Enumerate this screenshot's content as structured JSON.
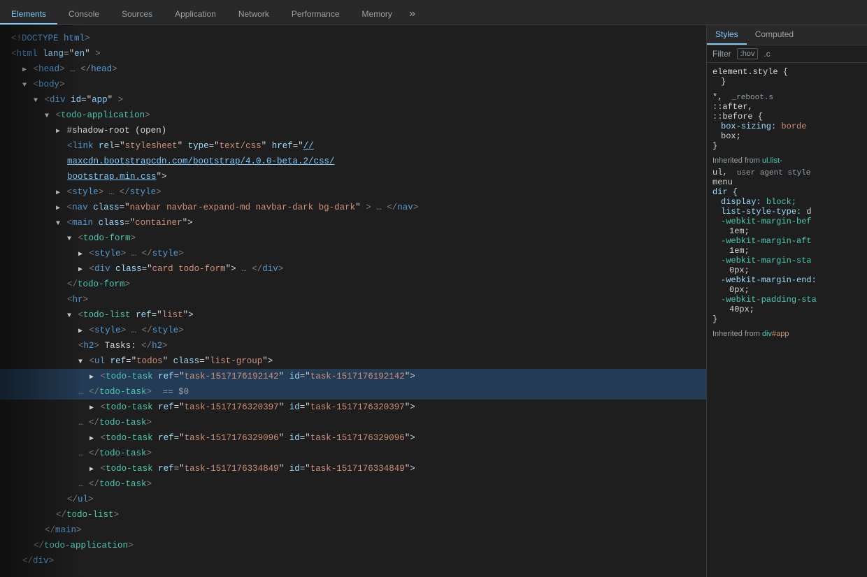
{
  "tabs": {
    "items": [
      {
        "label": "Elements",
        "active": false
      },
      {
        "label": "Console",
        "active": false
      },
      {
        "label": "Sources",
        "active": false
      },
      {
        "label": "Application",
        "active": false
      },
      {
        "label": "Network",
        "active": false
      },
      {
        "label": "Performance",
        "active": false
      },
      {
        "label": "Memory",
        "active": false
      },
      {
        "label": "»",
        "active": false
      }
    ]
  },
  "styles_tabs": {
    "items": [
      {
        "label": "Styles",
        "active": true
      },
      {
        "label": "Computed",
        "active": false
      }
    ]
  },
  "filter": {
    "label": "Filter",
    "hov": ":hov",
    "dot": ".c"
  },
  "dom": {
    "lines": [
      {
        "indent": 0,
        "text": "<!DOCTYPE html>"
      },
      {
        "indent": 0,
        "text": "<html lang=\"en\">"
      },
      {
        "indent": 1,
        "text": "▶ <head>…</head>"
      },
      {
        "indent": 1,
        "text": "▼ <body>"
      },
      {
        "indent": 2,
        "text": "▼ <div id=\"app\">"
      },
      {
        "indent": 3,
        "text": "▼ <todo-application>"
      },
      {
        "indent": 4,
        "text": "▶ #shadow-root (open)"
      },
      {
        "indent": 5,
        "text": "<link rel=\"stylesheet\" type=\"text/css\" href=\"//"
      },
      {
        "indent": 5,
        "text": "maxcdn.bootstrapcdn.com/bootstrap/4.0.0-beta.2/css/"
      },
      {
        "indent": 5,
        "text": "bootstrap.min.css\">"
      },
      {
        "indent": 4,
        "text": "▶ <style>…</style>"
      },
      {
        "indent": 4,
        "text": "▶ <nav class=\"navbar navbar-expand-md navbar-dark bg-dark\">…</nav>"
      },
      {
        "indent": 4,
        "text": "▼ <main class=\"container\">"
      },
      {
        "indent": 5,
        "text": "▼ <todo-form>"
      },
      {
        "indent": 6,
        "text": "▶ <style>…</style>"
      },
      {
        "indent": 6,
        "text": "▶ <div class=\"card todo-form\">…</div>"
      },
      {
        "indent": 5,
        "text": "</todo-form>"
      },
      {
        "indent": 5,
        "text": "<hr>"
      },
      {
        "indent": 5,
        "text": "▼ <todo-list ref=\"list\">"
      },
      {
        "indent": 6,
        "text": "▶ <style>…</style>"
      },
      {
        "indent": 6,
        "text": "<h2>Tasks:</h2>"
      },
      {
        "indent": 6,
        "text": "▼ <ul ref=\"todos\" class=\"list-group\">"
      },
      {
        "indent": 7,
        "text": "▶ <todo-task ref=\"task-1517176192142\" id=\"task-1517176192142\">"
      },
      {
        "indent": 6,
        "text": "…</todo-task> == $0"
      },
      {
        "indent": 7,
        "text": "▶ <todo-task ref=\"task-1517176320397\" id=\"task-1517176320397\">"
      },
      {
        "indent": 6,
        "text": "…</todo-task>"
      },
      {
        "indent": 7,
        "text": "▶ <todo-task ref=\"task-1517176329096\" id=\"task-1517176329096\">"
      },
      {
        "indent": 6,
        "text": "…</todo-task>"
      },
      {
        "indent": 7,
        "text": "▶ <todo-task ref=\"task-1517176334849\" id=\"task-1517176334849\">"
      },
      {
        "indent": 6,
        "text": "…</todo-task>"
      },
      {
        "indent": 5,
        "text": "</ul>"
      },
      {
        "indent": 4,
        "text": "</todo-list>"
      },
      {
        "indent": 3,
        "text": "</main>"
      },
      {
        "indent": 2,
        "text": "</todo-application>"
      },
      {
        "indent": 1,
        "text": "</div>"
      }
    ]
  },
  "styles_panel": {
    "element_style": "element.style {",
    "brace_close": "}",
    "wildcard_selector": "*,",
    "after_before": "::after,",
    "before": "::before {",
    "box_sizing_prop": "box-sizing:",
    "box_sizing_val": "borde",
    "box_prop2": "box;",
    "inherited_label1": "Inherited from",
    "inherited_sel1": "ul.list-",
    "ul_label": "ul,",
    "user_agent": "user agent style",
    "menu_label": "menu",
    "dir_prop": "dir {",
    "display_prop": "display:",
    "display_val": "block;",
    "list_style_prop": "list-style-type:",
    "list_style_val": "d",
    "webkit_margin_bef": "-webkit-margin-bef",
    "webkit_margin_bef_val": "1em;",
    "webkit_margin_aft": "-webkit-margin-aft",
    "webkit_margin_aft_val": "1em;",
    "webkit_margin_sta": "-webkit-margin-sta",
    "webkit_margin_sta_val": "0px;",
    "webkit_margin_end": "-webkit-margin-end:",
    "webkit_margin_end_val": "0px;",
    "webkit_padding_sta": "-webkit-padding-sta",
    "webkit_padding_sta_val": "40px;",
    "inherited_label2": "Inherited from",
    "inherited_sel2": "div#app"
  }
}
